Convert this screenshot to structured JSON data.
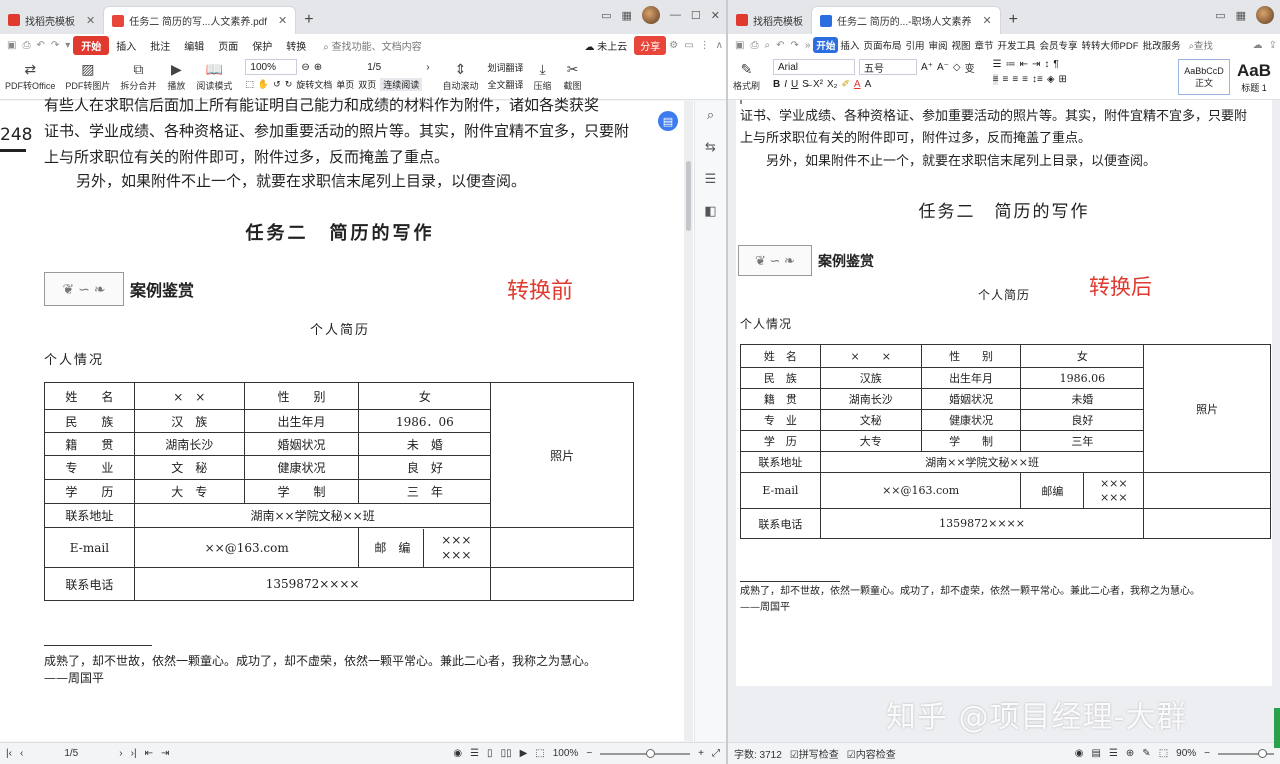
{
  "left": {
    "tabs": [
      {
        "label": "找稻壳模板",
        "active": false,
        "icon": "wps-red-icon"
      },
      {
        "label": "任务二 简历的写...人文素养.pdf",
        "active": true,
        "icon": "pdf-icon"
      }
    ],
    "tab_add": "+",
    "menu": {
      "start": "开始",
      "items": [
        "插入",
        "批注",
        "编辑",
        "页面",
        "保护",
        "转换"
      ],
      "search": "查找功能、文档内容",
      "cloud": "未上云",
      "share": "分享"
    },
    "toolbar": {
      "items": [
        {
          "icon": "pdf-to-office-icon",
          "label": "PDF转Office"
        },
        {
          "icon": "pdf-to-image-icon",
          "label": "PDF转图片"
        },
        {
          "icon": "split-merge-icon",
          "label": "拆分合并"
        },
        {
          "icon": "play-icon",
          "label": "播放"
        },
        {
          "icon": "read-mode-icon",
          "label": "阅读模式"
        }
      ],
      "zoom": "100%",
      "page": "1/5",
      "rotate_label": "旋转文档",
      "single_page": "单页",
      "double_page": "双页",
      "continuous": "连续阅读",
      "auto_scroll": "自动滚动",
      "translate_word": "划词翻译",
      "translate_full": "全文翻译",
      "compress": "压缩",
      "screenshot": "截图"
    },
    "doc": {
      "page_number": "248",
      "para1": "有些人在求职信后面加上所有能证明自己能力和成绩的材料作为附件，诸如各类获奖",
      "para2": "证书、学业成绩、各种资格证、参加重要活动的照片等。其实，附件宜精不宜多，只要附",
      "para3": "上与所求职位有关的附件即可，附件过多，反而掩盖了重点。",
      "para4": "另外，如果附件不止一个，就要在求职信末尾列上目录，以便查阅。",
      "section_title": "任务二　简历的写作",
      "case_label": "案例鉴赏",
      "conversion_label": "转换前",
      "resume_title": "个人简历",
      "personal_info": "个人情况",
      "table": {
        "rows": [
          [
            "姓　　名",
            "×　×",
            "性　　别",
            "女"
          ],
          [
            "民　　族",
            "汉　族",
            "出生年月",
            "1986．06"
          ],
          [
            "籍　　贯",
            "湖南长沙",
            "婚姻状况",
            "未　婚"
          ],
          [
            "专　　业",
            "文　秘",
            "健康状况",
            "良　好"
          ],
          [
            "学　　历",
            "大　专",
            "学　　制",
            "三　年"
          ]
        ],
        "photo": "照片",
        "address_label": "联系地址",
        "address": "湖南××学院文秘××班",
        "email_label": "E-mail",
        "email": "××@163.com",
        "postcode_label": "邮　编",
        "postcode": "×××\n×××",
        "phone_label": "联系电话",
        "phone": "1359872××××"
      },
      "quote": "成熟了，却不世故，依然一颗童心。成功了，却不虚荣，依然一颗平常心。兼此二心者，我称之为慧心。",
      "quote_author": "——周国平"
    },
    "status": {
      "page": "1/5",
      "zoom": "100%"
    }
  },
  "right": {
    "tabs": [
      {
        "label": "找稻壳模板",
        "active": false,
        "icon": "wps-red-icon"
      },
      {
        "label": "任务二 简历的...-职场人文素养",
        "active": true,
        "icon": "word-icon"
      }
    ],
    "tab_add": "+",
    "menu": {
      "start": "开始",
      "items": [
        "插入",
        "页面布局",
        "引用",
        "审阅",
        "视图",
        "章节",
        "开发工具",
        "会员专享",
        "转转大师PDF",
        "批改服务"
      ],
      "search": "查找"
    },
    "toolbar": {
      "format_painter": "格式刷",
      "font": "Arial",
      "size": "五号",
      "style_normal_preview": "AaBbCcD",
      "style_normal": "正文",
      "style_h1_preview": "AaB",
      "style_h1": "标题 1"
    },
    "doc": {
      "para2": "证书、学业成绩、各种资格证、参加重要活动的照片等。其实，附件宜精不宜多，只要附",
      "para3": "上与所求职位有关的附件即可，附件过多，反而掩盖了重点。",
      "para4": "另外，如果附件不止一个，就要在求职信末尾列上目录，以便查阅。",
      "section_title": "任务二　简历的写作",
      "case_label": "案例鉴赏",
      "conversion_label": "转换后",
      "resume_title": "个人简历",
      "personal_info": "个人情况",
      "table": {
        "rows": [
          [
            "姓　名",
            "×　　×",
            "性　　别",
            "女"
          ],
          [
            "民　族",
            "汉族",
            "出生年月",
            "1986.06"
          ],
          [
            "籍　贯",
            "湖南长沙",
            "婚姻状况",
            "未婚"
          ],
          [
            "专　业",
            "文秘",
            "健康状况",
            "良好"
          ],
          [
            "学　历",
            "大专",
            "学　　制",
            "三年"
          ]
        ],
        "photo": "照片",
        "address_label": "联系地址",
        "address": "湖南××学院文秘××班",
        "email_label": "E-mail",
        "email": "××@163.com",
        "postcode_label": "邮编",
        "postcode": "×××\n×××",
        "phone_label": "联系电话",
        "phone": "1359872××××"
      },
      "quote": "成熟了，却不世故，依然一颗童心。成功了，却不虚荣，依然一颗平常心。兼此二心者，我称之为慧心。",
      "quote_author": "——周国平"
    },
    "status": {
      "word_count": "字数: 3712",
      "spell_check": "拼写检查",
      "content_check": "内容检查",
      "zoom": "90%"
    },
    "watermark": "知乎 @项目经理-大群"
  }
}
